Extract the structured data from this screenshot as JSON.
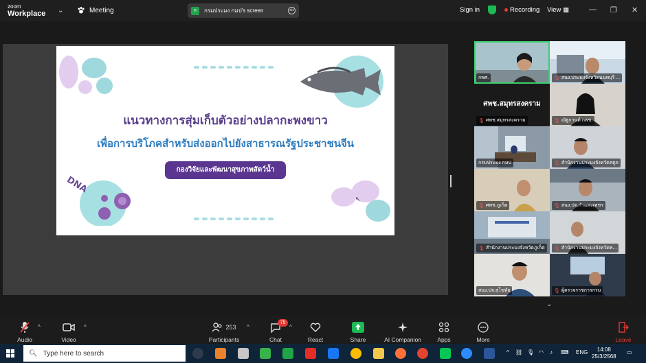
{
  "titlebar": {
    "brand_top": "zoom",
    "brand_bottom": "Workplace",
    "meeting_label": "Meeting",
    "share_badge": "n",
    "share_label": "กรมประมง กมป's screen",
    "signin": "Sign in",
    "recording": "Recording",
    "view": "View",
    "min": "—",
    "restore": "❐",
    "close": "✕"
  },
  "slide": {
    "title_line1": "แนวทางการสุ่มเก็บตัวอย่างปลากะพงขาว",
    "title_line2": "เพื่อการบริโภคสำหรับส่งออกไปยังสาธารณรัฐประชาชนจีน",
    "department": "กองวิจัยและพัฒนาสุขภาพสัตว์น้ำ",
    "dna_text": "DNA"
  },
  "gallery": {
    "tiles": [
      {
        "name": "กพศ."
      },
      {
        "name": "สนง.ประมงจังหวัดนนทบุรี ..."
      },
      {
        "name": "ศพช.สมุทรสงคราม",
        "big": "ศพช.สมุทรสงคราม"
      },
      {
        "name": "ณัฐกานต์ กพช."
      },
      {
        "name": "กรมประมง กมป"
      },
      {
        "name": "สำนักงานประมงจังหวัดสตูล"
      },
      {
        "name": "ศพช.ภูเก็ต"
      },
      {
        "name": "สนง.ปจ.กำแพงเพชร"
      },
      {
        "name": "สำนักงานประมงจังหวัดภูเก็ต"
      },
      {
        "name": "สำนักงานประมงจังหวัดพ..."
      },
      {
        "name": "สนง.ปจ.สุโขทัย"
      },
      {
        "name": "ผู้ตรวจราชการกรม"
      }
    ]
  },
  "toolbar": {
    "audio": "Audio",
    "video": "Video",
    "participants": "Participants",
    "participants_count": "253",
    "chat": "Chat",
    "chat_badge": "75",
    "react": "React",
    "share": "Share",
    "ai": "AI Companion",
    "apps": "Apps",
    "more": "More",
    "leave": "Leave"
  },
  "taskbar": {
    "search_placeholder": "Type here to search",
    "lang": "ENG",
    "time": "14:08",
    "date": "25/3/2568"
  }
}
